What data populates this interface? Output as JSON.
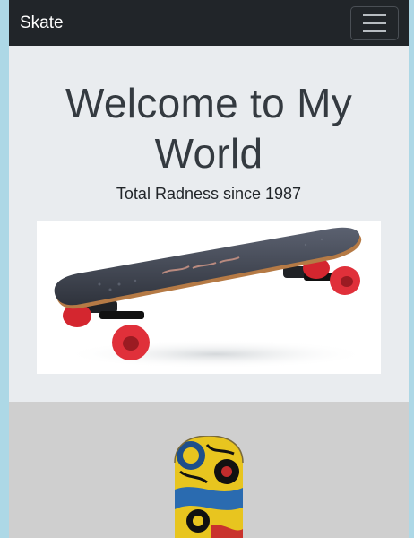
{
  "navbar": {
    "brand": "Skate",
    "toggler_icon": "hamburger-icon"
  },
  "hero": {
    "title": "Welcome to My World",
    "subtitle": "Total Radness since 1987",
    "image_icon": "skateboard-image"
  },
  "gallery": {
    "image_icon": "skateboard-deck-image"
  },
  "colors": {
    "page_frame": "#add8e6",
    "navbar_bg": "#212529",
    "hero_bg": "#e9ecef",
    "section_bg": "#cfcfcf",
    "wheel_red": "#e0303a"
  }
}
